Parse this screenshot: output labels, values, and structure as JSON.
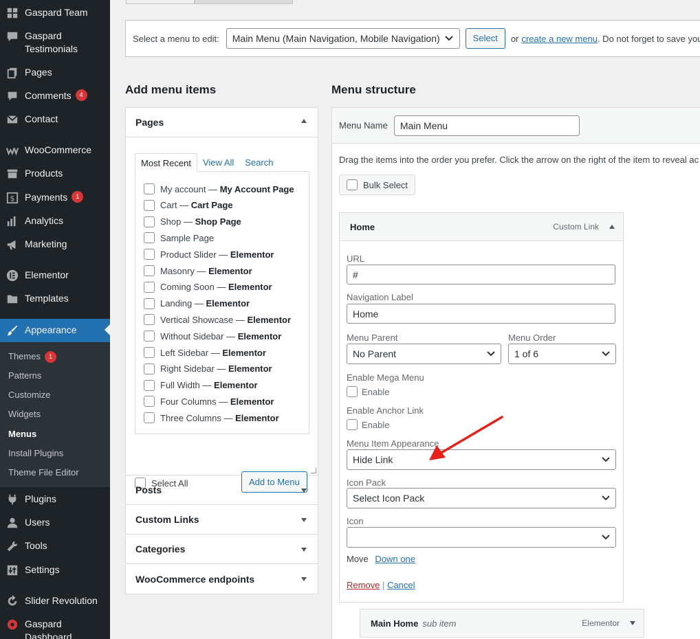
{
  "sidebar": {
    "items": [
      {
        "label": "Gaspard Team",
        "icon": "grid-icon"
      },
      {
        "label": "Gaspard Testimonials",
        "icon": "quote-icon"
      },
      {
        "label": "Pages",
        "icon": "pages-icon"
      },
      {
        "label": "Comments",
        "icon": "comment-icon",
        "badge": "4"
      },
      {
        "label": "Contact",
        "icon": "mail-icon"
      },
      {
        "label": "WooCommerce",
        "icon": "woo-icon"
      },
      {
        "label": "Products",
        "icon": "archive-icon"
      },
      {
        "label": "Payments",
        "icon": "dollar-icon",
        "badge": "1"
      },
      {
        "label": "Analytics",
        "icon": "bar-chart-icon"
      },
      {
        "label": "Marketing",
        "icon": "megaphone-icon"
      },
      {
        "label": "Elementor",
        "icon": "elementor-icon"
      },
      {
        "label": "Templates",
        "icon": "folder-icon"
      },
      {
        "label": "Appearance",
        "icon": "paintbrush-icon"
      },
      {
        "label": "Plugins",
        "icon": "plug-icon"
      },
      {
        "label": "Users",
        "icon": "user-icon"
      },
      {
        "label": "Tools",
        "icon": "wrench-icon"
      },
      {
        "label": "Settings",
        "icon": "sliders-icon"
      },
      {
        "label": "Slider Revolution",
        "icon": "refresh-icon"
      },
      {
        "label": "Gaspard Dashboard",
        "icon": "circle-icon"
      }
    ],
    "submenu": [
      {
        "label": "Themes",
        "badge": "1"
      },
      {
        "label": "Patterns"
      },
      {
        "label": "Customize"
      },
      {
        "label": "Widgets"
      },
      {
        "label": "Menus",
        "current": true
      },
      {
        "label": "Install Plugins"
      },
      {
        "label": "Theme File Editor"
      }
    ]
  },
  "manage": {
    "label": "Select a menu to edit:",
    "selected_menu": "Main Menu (Main Navigation, Mobile Navigation)",
    "select_button": "Select",
    "or_text": "or",
    "create_link": "create a new menu",
    "tail_text": ". Do not forget to save your"
  },
  "add_items": {
    "heading": "Add menu items",
    "pages": {
      "title": "Pages",
      "tabs": [
        "Most Recent",
        "View All",
        "Search"
      ],
      "list": [
        {
          "name": "My account",
          "tag": "My Account Page"
        },
        {
          "name": "Cart",
          "tag": "Cart Page"
        },
        {
          "name": "Shop",
          "tag": "Shop Page"
        },
        {
          "name": "Sample Page",
          "tag": ""
        },
        {
          "name": "Product Slider",
          "tag": "Elementor"
        },
        {
          "name": "Masonry",
          "tag": "Elementor"
        },
        {
          "name": "Coming Soon",
          "tag": "Elementor"
        },
        {
          "name": "Landing",
          "tag": "Elementor"
        },
        {
          "name": "Vertical Showcase",
          "tag": "Elementor"
        },
        {
          "name": "Without Sidebar",
          "tag": "Elementor"
        },
        {
          "name": "Left Sidebar",
          "tag": "Elementor"
        },
        {
          "name": "Right Sidebar",
          "tag": "Elementor"
        },
        {
          "name": "Full Width",
          "tag": "Elementor"
        },
        {
          "name": "Four Columns",
          "tag": "Elementor"
        },
        {
          "name": "Three Columns",
          "tag": "Elementor"
        }
      ],
      "select_all": "Select All",
      "add_button": "Add to Menu"
    },
    "other_sections": [
      "Posts",
      "Custom Links",
      "Categories",
      "WooCommerce endpoints"
    ]
  },
  "structure": {
    "heading": "Menu structure",
    "menu_name_label": "Menu Name",
    "menu_name_value": "Main Menu",
    "instructions": "Drag the items into the order you prefer. Click the arrow on the right of the item to reveal ac",
    "bulk_select": "Bulk Select",
    "item": {
      "title": "Home",
      "type": "Custom Link",
      "url_label": "URL",
      "url_value": "#",
      "nav_label_label": "Navigation Label",
      "nav_label_value": "Home",
      "parent_label": "Menu Parent",
      "parent_value": "No Parent",
      "order_label": "Menu Order",
      "order_value": "1 of 6",
      "mega_label": "Enable Mega Menu",
      "mega_cb": "Enable",
      "anchor_label": "Enable Anchor Link",
      "anchor_cb": "Enable",
      "appearance_label": "Menu Item Appearance",
      "appearance_value": "Hide Link",
      "icon_pack_label": "Icon Pack",
      "icon_pack_value": "Select Icon Pack",
      "icon_label": "Icon",
      "icon_value": "",
      "move_label": "Move",
      "move_link": "Down one",
      "remove_link": "Remove",
      "separator": "|",
      "cancel_link": "Cancel"
    },
    "sub_item": {
      "title": "Main Home",
      "subtitle": "sub item",
      "type": "Elementor"
    }
  },
  "colors": {
    "accent": "#2271b1",
    "annotation_arrow": "#e8201a",
    "badge": "#d63638"
  }
}
